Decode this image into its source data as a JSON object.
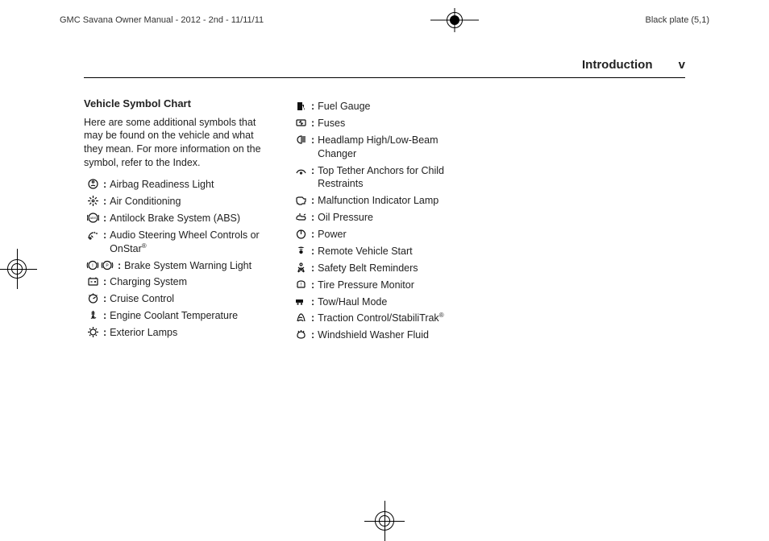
{
  "print_header": {
    "left": "GMC Savana Owner Manual - 2012 - 2nd - 11/11/11",
    "right": "Black plate (5,1)"
  },
  "running_head": {
    "section": "Introduction",
    "pageno": "v"
  },
  "heading": "Vehicle Symbol Chart",
  "intro": "Here are some additional symbols that may be found on the vehicle and what they mean. For more information on the symbol, refer to the Index.",
  "col1": [
    {
      "icon": "airbag",
      "label": "Airbag Readiness Light"
    },
    {
      "icon": "ac",
      "label": "Air Conditioning"
    },
    {
      "icon": "abs",
      "label": "Antilock Brake System (ABS)"
    },
    {
      "icon": "audio-wheel",
      "label": "Audio Steering Wheel Controls or OnStar",
      "sup": "®"
    },
    {
      "icon": "brake-warning",
      "label": "Brake System Warning Light",
      "wide": true
    },
    {
      "icon": "battery",
      "label": "Charging System"
    },
    {
      "icon": "cruise",
      "label": "Cruise Control"
    },
    {
      "icon": "coolant",
      "label": "Engine Coolant Temperature"
    },
    {
      "icon": "lamp",
      "label": "Exterior Lamps"
    }
  ],
  "col2": [
    {
      "icon": "fuel",
      "label": "Fuel Gauge",
      "fill": true
    },
    {
      "icon": "fuse",
      "label": "Fuses"
    },
    {
      "icon": "headlamp",
      "label": "Headlamp High/Low-Beam Changer"
    },
    {
      "icon": "tether",
      "label": "Top Tether Anchors for Child Restraints"
    },
    {
      "icon": "mil",
      "label": "Malfunction Indicator Lamp"
    },
    {
      "icon": "oil",
      "label": "Oil Pressure"
    },
    {
      "icon": "power",
      "label": "Power"
    },
    {
      "icon": "remote",
      "label": "Remote Vehicle Start",
      "fill": true
    },
    {
      "icon": "seatbelt",
      "label": "Safety Belt Reminders"
    },
    {
      "icon": "tpms",
      "label": "Tire Pressure Monitor"
    },
    {
      "icon": "towhaul",
      "label": "Tow/Haul Mode",
      "fill": true
    },
    {
      "icon": "traction",
      "label": "Traction Control/StabiliTrak",
      "sup": "®"
    },
    {
      "icon": "washer",
      "label": "Windshield Washer Fluid"
    }
  ]
}
